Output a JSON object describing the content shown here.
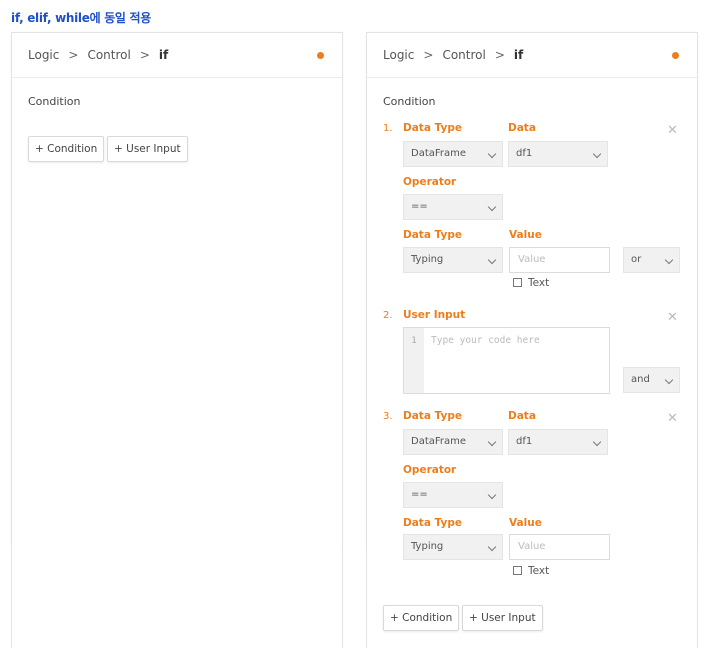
{
  "caption": "if, elif, while에 동일 적용",
  "left_panel": {
    "breadcrumb": [
      "Logic",
      "Control",
      "if"
    ],
    "condition_title": "Condition",
    "add_condition_label": "+ Condition",
    "add_user_input_label": "+ User Input"
  },
  "right_panel": {
    "breadcrumb": [
      "Logic",
      "Control",
      "if"
    ],
    "condition_title": "Condition",
    "conditions": [
      {
        "number": "1.",
        "type": "condition",
        "data_type_label": "Data Type",
        "data_type_value": "DataFrame",
        "data_label": "Data",
        "data_value": "df1",
        "operator_label": "Operator",
        "operator_value": "==",
        "value_data_type_label": "Data Type",
        "value_data_type_value": "Typing",
        "value_label": "Value",
        "value_placeholder": "Value",
        "text_checkbox_label": "Text",
        "connector": "or"
      },
      {
        "number": "2.",
        "type": "user_input",
        "label": "User Input",
        "line_number": "1",
        "placeholder": "Type your code here",
        "connector": "and"
      },
      {
        "number": "3.",
        "type": "condition",
        "data_type_label": "Data Type",
        "data_type_value": "DataFrame",
        "data_label": "Data",
        "data_value": "df1",
        "operator_label": "Operator",
        "operator_value": "==",
        "value_data_type_label": "Data Type",
        "value_data_type_value": "Typing",
        "value_label": "Value",
        "value_placeholder": "Value",
        "text_checkbox_label": "Text"
      }
    ],
    "add_condition_label": "+ Condition",
    "add_user_input_label": "+ User Input"
  },
  "colors": {
    "accent": "#ef7d1a",
    "caption": "#1f4fc9",
    "border": "#e3e3e3"
  }
}
